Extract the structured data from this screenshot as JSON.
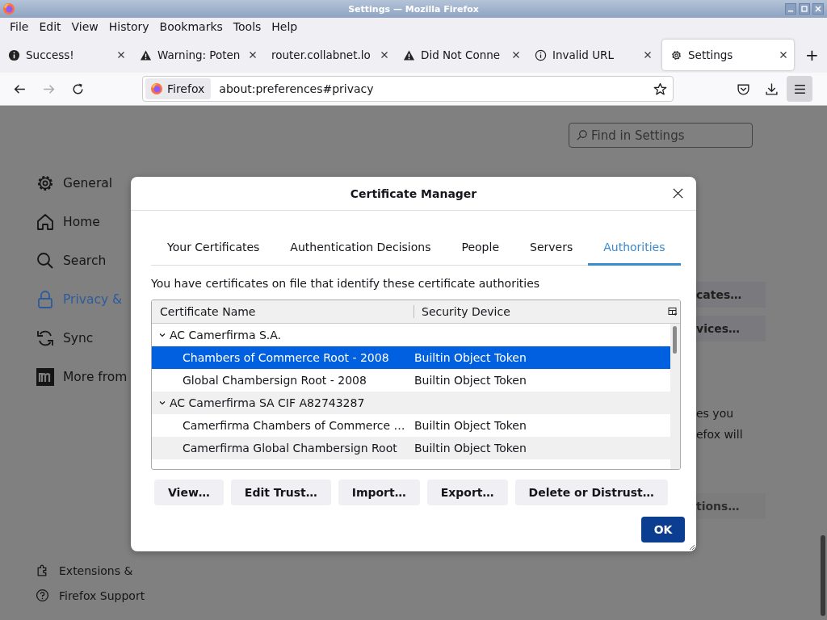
{
  "window": {
    "title": "Settings — Mozilla Firefox"
  },
  "menu_bar": [
    "File",
    "Edit",
    "View",
    "History",
    "Bookmarks",
    "Tools",
    "Help"
  ],
  "tabs": [
    {
      "title": "Success!",
      "kind": "info",
      "selected": false
    },
    {
      "title": "Warning: Poten",
      "kind": "warning",
      "selected": false
    },
    {
      "title": "router.collabnet.lo",
      "kind": "plain",
      "selected": false
    },
    {
      "title": "Did Not Conne",
      "kind": "warning",
      "selected": false
    },
    {
      "title": "Invalid URL",
      "kind": "notice",
      "selected": false
    },
    {
      "title": "Settings",
      "kind": "settings",
      "selected": true
    }
  ],
  "new_tab": "+",
  "nav_buttons": [
    {
      "kind": "back",
      "disabled": false
    },
    {
      "kind": "forward",
      "disabled": true
    },
    {
      "kind": "reload",
      "disabled": false
    }
  ],
  "address_bar": {
    "identity": "Firefox",
    "url": "about:preferences#privacy"
  },
  "settings_page": {
    "search": {
      "placeholder": "Find in Settings"
    },
    "sidebar": [
      {
        "label": "General",
        "kind": "general",
        "selected": false
      },
      {
        "label": "Home",
        "kind": "home",
        "selected": false
      },
      {
        "label": "Search",
        "kind": "search",
        "selected": false
      },
      {
        "label": "Privacy &",
        "kind": "privacy",
        "selected": true
      },
      {
        "label": "Sync",
        "kind": "sync",
        "selected": false
      },
      {
        "label": "More from",
        "kind": "mozilla",
        "selected": false
      }
    ],
    "footer_links": [
      {
        "label": "Extensions &",
        "kind": "extensions"
      },
      {
        "label": "Firefox Support",
        "kind": "support"
      }
    ],
    "right_fragments": [
      {
        "kind": "button",
        "text": "cates…"
      },
      {
        "kind": "button",
        "text": "vices…"
      },
      {
        "kind": "text",
        "text": "es you"
      },
      {
        "kind": "text",
        "text": "efox will"
      },
      {
        "kind": "button",
        "text": "tions…"
      }
    ]
  },
  "dialog": {
    "title": "Certificate Manager",
    "tabs": [
      {
        "label": "Your Certificates",
        "selected": false
      },
      {
        "label": "Authentication Decisions",
        "selected": false
      },
      {
        "label": "People",
        "selected": false
      },
      {
        "label": "Servers",
        "selected": false
      },
      {
        "label": "Authorities",
        "selected": true
      }
    ],
    "description": "You have certificates on file that identify these certificate authorities",
    "tree": {
      "columns": [
        "Certificate Name",
        "Security Device"
      ],
      "rows": [
        {
          "name": "AC Camerfirma S.A.",
          "expanded": true,
          "selected": false,
          "children": [
            {
              "name": "Chambers of Commerce Root - 2008",
              "device": "Builtin Object Token",
              "selected": true
            },
            {
              "name": "Global Chambersign Root - 2008",
              "device": "Builtin Object Token",
              "selected": false
            }
          ]
        },
        {
          "name": "AC Camerfirma SA CIF A82743287",
          "expanded": true,
          "selected": false,
          "children": [
            {
              "name": "Camerfirma Chambers of Commerce …",
              "device": "Builtin Object Token",
              "selected": false
            },
            {
              "name": "Camerfirma Global Chambersign Root",
              "device": "Builtin Object Token",
              "selected": false
            }
          ]
        }
      ]
    },
    "buttons": [
      "View…",
      "Edit Trust…",
      "Import…",
      "Export…",
      "Delete or Distrust…"
    ],
    "ok": "OK"
  }
}
